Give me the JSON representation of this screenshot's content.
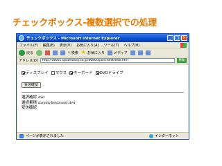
{
  "slide": {
    "title": "チェックボックス-複数選択での処理"
  },
  "window": {
    "title": "チェックボックス - Microsoft Internet Explorer",
    "minimize": "_",
    "maximize": "□",
    "close": "×"
  },
  "menu": {
    "items": [
      "ファイル(F)",
      "編集(E)",
      "表示(V)",
      "お気に入り(A)",
      "ツール(T)",
      "ヘルプ(H)"
    ]
  },
  "toolbar": {
    "back_label": "戻る",
    "search_label": "検索",
    "favorites_label": "お気に入り",
    "media_label": "メディア"
  },
  "address": {
    "label": "アドレス(D)",
    "value": "http://co001.spacesway.co.jp:8080/ajax/check/Box.htm",
    "go_label": "移動"
  },
  "form": {
    "checkboxes": [
      {
        "label": "ディスプレイ",
        "checked": true
      },
      {
        "label": "マウス",
        "checked": false
      },
      {
        "label": "キーボード",
        "checked": true
      },
      {
        "label": "DVDドライブ",
        "checked": true
      }
    ],
    "submit_label": "受信確認"
  },
  "results": {
    "rows": [
      {
        "label": "選択確認",
        "value": "dvd"
      },
      {
        "label": "選択累積",
        "value": "display,keyboard,dvd"
      },
      {
        "label": "受信確認",
        "value": ""
      }
    ]
  },
  "status": {
    "text": "ページが表示されました",
    "zone": "インターネット"
  }
}
